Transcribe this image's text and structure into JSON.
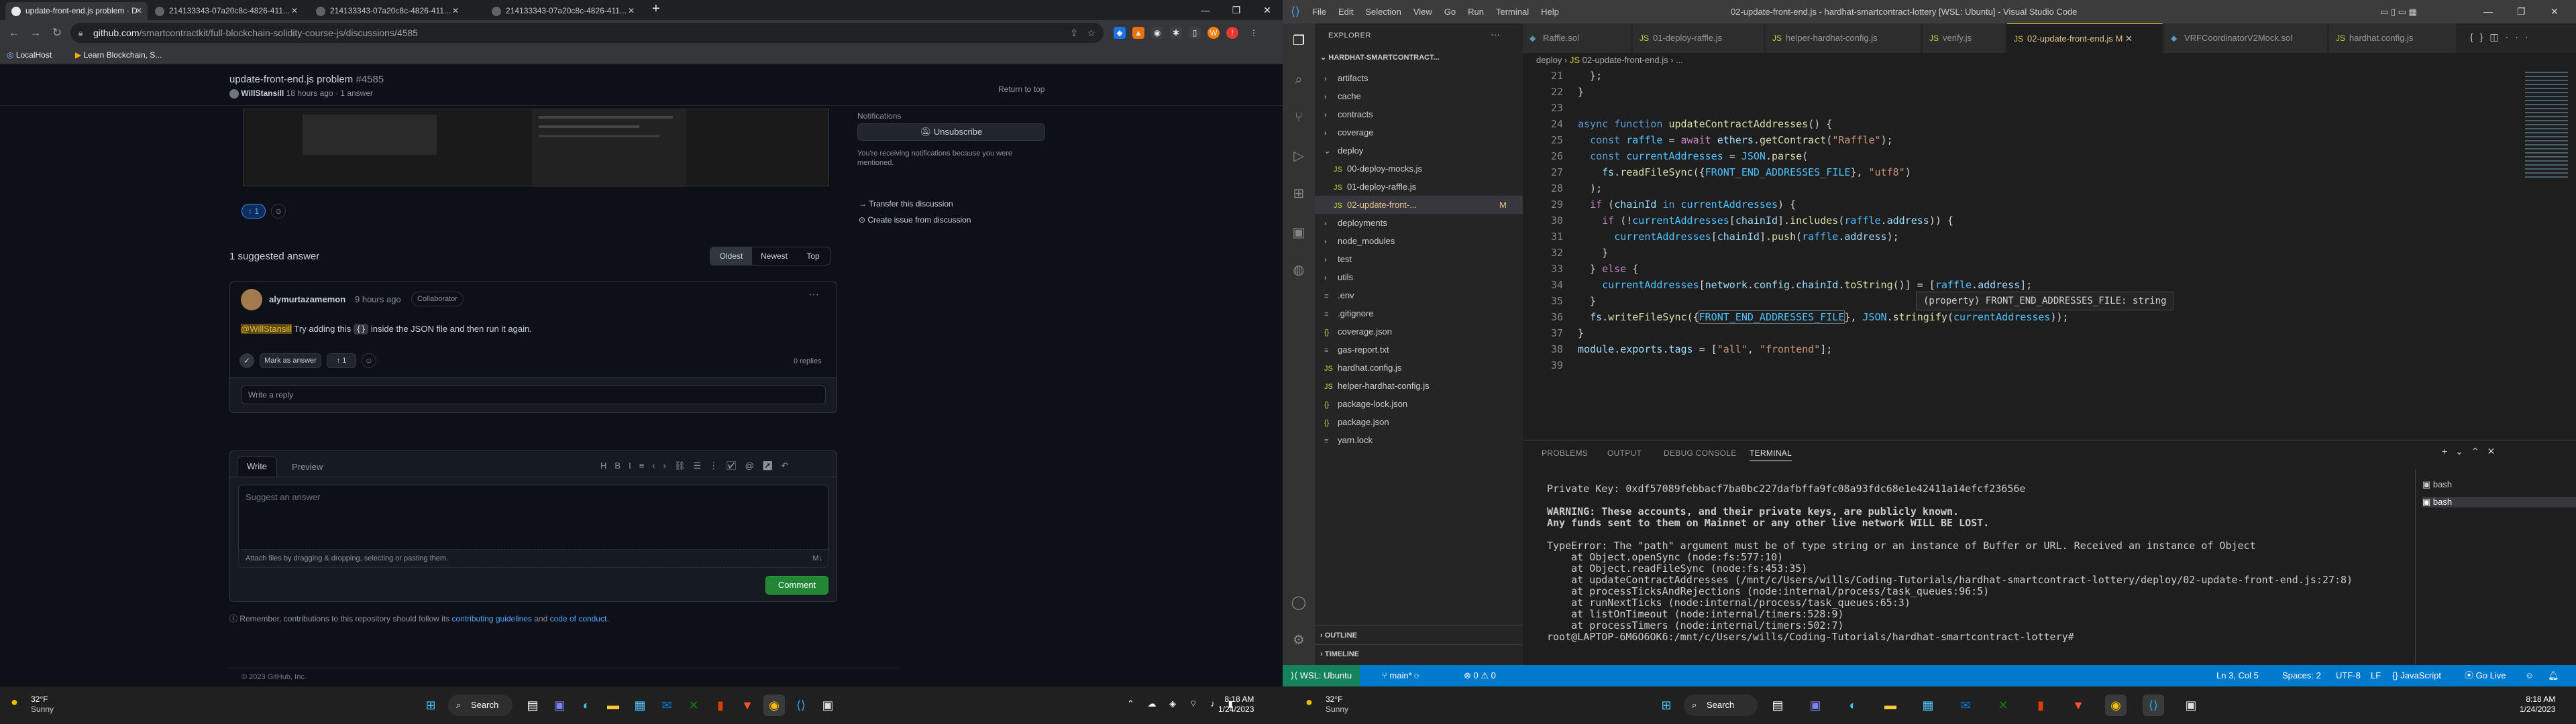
{
  "chrome": {
    "tabs": [
      {
        "title": "update-front-end.js problem · D"
      },
      {
        "title": "214133343-07a20c8c-4826-411..."
      },
      {
        "title": "214133343-07a20c8c-4826-411..."
      },
      {
        "title": "214133343-07a20c8c-4826-411..."
      }
    ],
    "new_tab": "+",
    "url_host": "github.com",
    "url_path": "/smartcontractkit/full-blockchain-solidity-course-js/discussions/4585",
    "bookmarks": [
      "LocalHost",
      "Learn Blockchain, S..."
    ],
    "profile_initial": "W"
  },
  "github": {
    "header_title": "update-front-end.js problem",
    "header_number": "#4585",
    "header_author": "WillStansill",
    "header_meta": "18 hours ago · 1 answer",
    "return_to_top": "Return to top",
    "reaction_count": "1",
    "notifications_label": "Notifications",
    "unsubscribe": "Unsubscribe",
    "notify_reason": "You're receiving notifications because you were mentioned.",
    "transfer": "Transfer this discussion",
    "create_issue": "Create issue from discussion",
    "suggested_count": "1 suggested answer",
    "sort": [
      "Oldest",
      "Newest",
      "Top"
    ],
    "answer": {
      "author": "alymurtazamemon",
      "time": "9 hours ago",
      "badge": "Collaborator",
      "mention": "@WillStansill",
      "text_a": " Try adding this ",
      "code": "{}",
      "text_b": " inside the JSON file and then run it again.",
      "mark": "Mark as answer",
      "upvotes": "1",
      "replies": "0 replies",
      "reply_placeholder": "Write a reply"
    },
    "composer": {
      "tab_write": "Write",
      "tab_preview": "Preview",
      "placeholder": "Suggest an answer",
      "attach": "Attach files by dragging & dropping, selecting or pasting them.",
      "submit": "Comment"
    },
    "remember": "Remember, contributions to this repository should follow its",
    "guidelines": "contributing guidelines",
    "and": " and ",
    "coc": "code of conduct",
    "footer": "© 2023 GitHub, Inc."
  },
  "vscode": {
    "menu": [
      "File",
      "Edit",
      "Selection",
      "View",
      "Go",
      "Run",
      "Terminal",
      "Help"
    ],
    "window_title": "02-update-front-end.js - hardhat-smartcontract-lottery [WSL: Ubuntu] - Visual Studio Code",
    "explorer_label": "EXPLORER",
    "project": "HARDHAT-SMARTCONTRACT...",
    "tree": [
      {
        "name": "artifacts",
        "kind": "folder",
        "depth": 0
      },
      {
        "name": "cache",
        "kind": "folder",
        "depth": 0
      },
      {
        "name": "contracts",
        "kind": "folder",
        "depth": 0
      },
      {
        "name": "coverage",
        "kind": "folder",
        "depth": 0
      },
      {
        "name": "deploy",
        "kind": "folder-open",
        "depth": 0
      },
      {
        "name": "00-deploy-mocks.js",
        "kind": "js",
        "depth": 1
      },
      {
        "name": "01-deploy-raffle.js",
        "kind": "js",
        "depth": 1
      },
      {
        "name": "02-update-front-...",
        "kind": "js",
        "depth": 1,
        "status": "M"
      },
      {
        "name": "deployments",
        "kind": "folder",
        "depth": 0
      },
      {
        "name": "node_modules",
        "kind": "folder",
        "depth": 0
      },
      {
        "name": "test",
        "kind": "folder",
        "depth": 0
      },
      {
        "name": "utils",
        "kind": "folder",
        "depth": 0
      },
      {
        "name": ".env",
        "kind": "file",
        "depth": 0
      },
      {
        "name": ".gitignore",
        "kind": "file",
        "depth": 0
      },
      {
        "name": "coverage.json",
        "kind": "json",
        "depth": 0
      },
      {
        "name": "gas-report.txt",
        "kind": "file",
        "depth": 0
      },
      {
        "name": "hardhat.config.js",
        "kind": "js",
        "depth": 0
      },
      {
        "name": "helper-hardhat-config.js",
        "kind": "js",
        "depth": 0
      },
      {
        "name": "package-lock.json",
        "kind": "json",
        "depth": 0
      },
      {
        "name": "package.json",
        "kind": "json",
        "depth": 0
      },
      {
        "name": "yarn.lock",
        "kind": "file",
        "depth": 0
      }
    ],
    "outline": "OUTLINE",
    "timeline": "TIMELINE",
    "tabs": [
      {
        "name": "Raffle.sol"
      },
      {
        "name": "01-deploy-raffle.js"
      },
      {
        "name": "helper-hardhat-config.js"
      },
      {
        "name": "verify.js"
      },
      {
        "name": "02-update-front-end.js",
        "status": "M"
      },
      {
        "name": "VRFCoordinatorV2Mock.sol"
      },
      {
        "name": "hardhat.config.js"
      }
    ],
    "breadcrumb": [
      "deploy",
      "02-update-front-end.js",
      "..."
    ],
    "line_numbers": [
      "21",
      "22",
      "23",
      "24",
      "25",
      "26",
      "27",
      "28",
      "29",
      "30",
      "31",
      "32",
      "33",
      "34",
      "35",
      "36",
      "37",
      "38",
      "39"
    ],
    "hover": "(property) FRONT_END_ADDRESSES_FILE: string",
    "panel_tabs": [
      "PROBLEMS",
      "OUTPUT",
      "DEBUG CONSOLE",
      "TERMINAL"
    ],
    "terminal": [
      "Private Key: 0xdf57089febbacf7ba0bc227dafbffa9fc08a93fdc68e1e42411a14efcf23656e",
      "",
      "WARNING: These accounts, and their private keys, are publicly known.",
      "Any funds sent to them on Mainnet or any other live network WILL BE LOST.",
      "",
      "TypeError: The \"path\" argument must be of type string or an instance of Buffer or URL. Received an instance of Object",
      "    at Object.openSync (node:fs:577:10)",
      "    at Object.readFileSync (node:fs:453:35)",
      "    at updateContractAddresses (/mnt/c/Users/wills/Coding-Tutorials/hardhat-smartcontract-lottery/deploy/02-update-front-end.js:27:8)",
      "    at processTicksAndRejections (node:internal/process/task_queues:96:5)",
      "    at runNextTicks (node:internal/process/task_queues:65:3)",
      "    at listOnTimeout (node:internal/timers:528:9)",
      "    at processTimers (node:internal/timers:502:7)",
      "root@LAPTOP-6M6O6OK6:/mnt/c/Users/wills/Coding-Tutorials/hardhat-smartcontract-lottery#"
    ],
    "terminals": [
      "bash",
      "bash"
    ],
    "status": {
      "remote": "WSL: Ubuntu",
      "branch": "main*",
      "problems": "0 ⚠ 0",
      "position": "Ln 3, Col 5",
      "spaces": "Spaces: 2",
      "encoding": "UTF-8",
      "eol": "LF",
      "language": "JavaScript",
      "golive": "Go Live"
    }
  },
  "taskbar": {
    "left_weather": {
      "temp": "32°F",
      "cond": "Sunny"
    },
    "left_search": "Search",
    "left_time": "8:18 AM",
    "left_date": "1/24/2023",
    "right_weather": {
      "temp": "32°F",
      "cond": "Sunny"
    },
    "right_search": "Search",
    "right_time": "8:18 AM",
    "right_date": "1/24/2023"
  }
}
